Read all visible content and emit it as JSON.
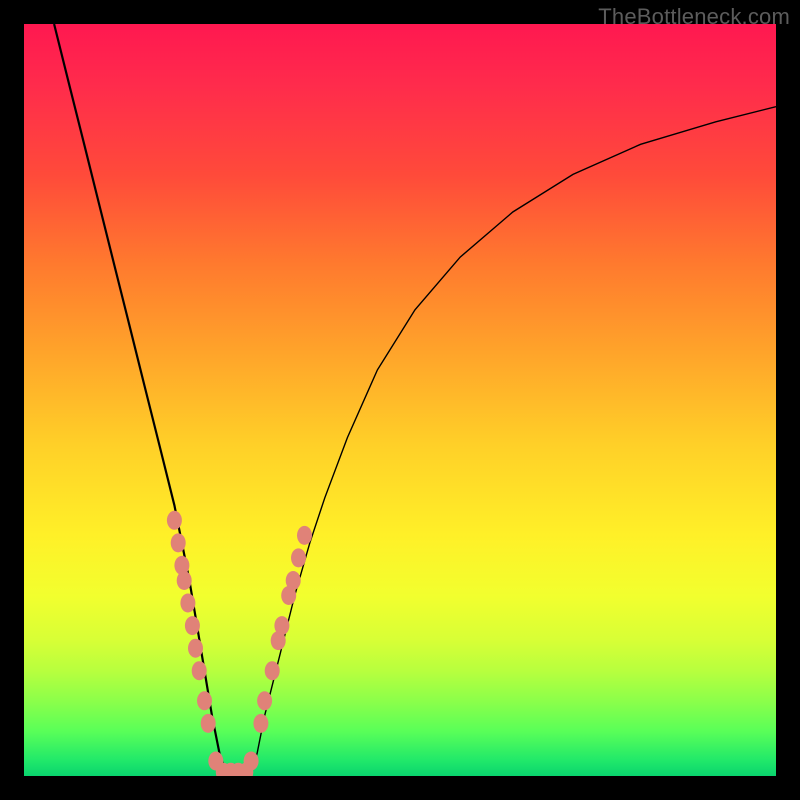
{
  "watermark": {
    "text": "TheBottleneck.com"
  },
  "colors": {
    "frame": "#000000",
    "curve": "#000000",
    "marker": "#e08278"
  },
  "chart_data": {
    "type": "line",
    "title": "",
    "xlabel": "",
    "ylabel": "",
    "xlim": [
      0,
      100
    ],
    "ylim": [
      0,
      100
    ],
    "grid": false,
    "legend": false,
    "note": "V-shaped bottleneck curve; y = percentage (0 at bottom/minimum, ~100 at top). x is normalized 0–100 across plot width. Values estimated from pixel positions.",
    "series": [
      {
        "name": "bottleneck-curve",
        "x": [
          4,
          6,
          8,
          10,
          12,
          14,
          16,
          18,
          20,
          22,
          23,
          24,
          25,
          26,
          27,
          28,
          29,
          30,
          31,
          32,
          34,
          36,
          38,
          40,
          43,
          47,
          52,
          58,
          65,
          73,
          82,
          92,
          100
        ],
        "y": [
          100,
          92,
          84,
          76,
          68,
          60,
          52,
          44,
          36,
          26,
          20,
          14,
          8,
          3,
          0,
          0,
          0,
          0,
          3,
          8,
          16,
          24,
          31,
          37,
          45,
          54,
          62,
          69,
          75,
          80,
          84,
          87,
          89
        ]
      }
    ],
    "markers": {
      "name": "highlighted-points",
      "note": "Salmon dots clustered near the curve minimum on both arms.",
      "points": [
        {
          "x": 20.0,
          "y": 34
        },
        {
          "x": 20.5,
          "y": 31
        },
        {
          "x": 21.0,
          "y": 28
        },
        {
          "x": 21.3,
          "y": 26
        },
        {
          "x": 21.8,
          "y": 23
        },
        {
          "x": 22.4,
          "y": 20
        },
        {
          "x": 22.8,
          "y": 17
        },
        {
          "x": 23.3,
          "y": 14
        },
        {
          "x": 24.0,
          "y": 10
        },
        {
          "x": 24.5,
          "y": 7
        },
        {
          "x": 25.5,
          "y": 2
        },
        {
          "x": 26.5,
          "y": 0.5
        },
        {
          "x": 27.5,
          "y": 0.5
        },
        {
          "x": 28.5,
          "y": 0.5
        },
        {
          "x": 29.5,
          "y": 0.5
        },
        {
          "x": 30.2,
          "y": 2
        },
        {
          "x": 31.5,
          "y": 7
        },
        {
          "x": 32.0,
          "y": 10
        },
        {
          "x": 33.0,
          "y": 14
        },
        {
          "x": 33.8,
          "y": 18
        },
        {
          "x": 34.3,
          "y": 20
        },
        {
          "x": 35.2,
          "y": 24
        },
        {
          "x": 35.8,
          "y": 26
        },
        {
          "x": 36.5,
          "y": 29
        },
        {
          "x": 37.3,
          "y": 32
        }
      ]
    }
  }
}
